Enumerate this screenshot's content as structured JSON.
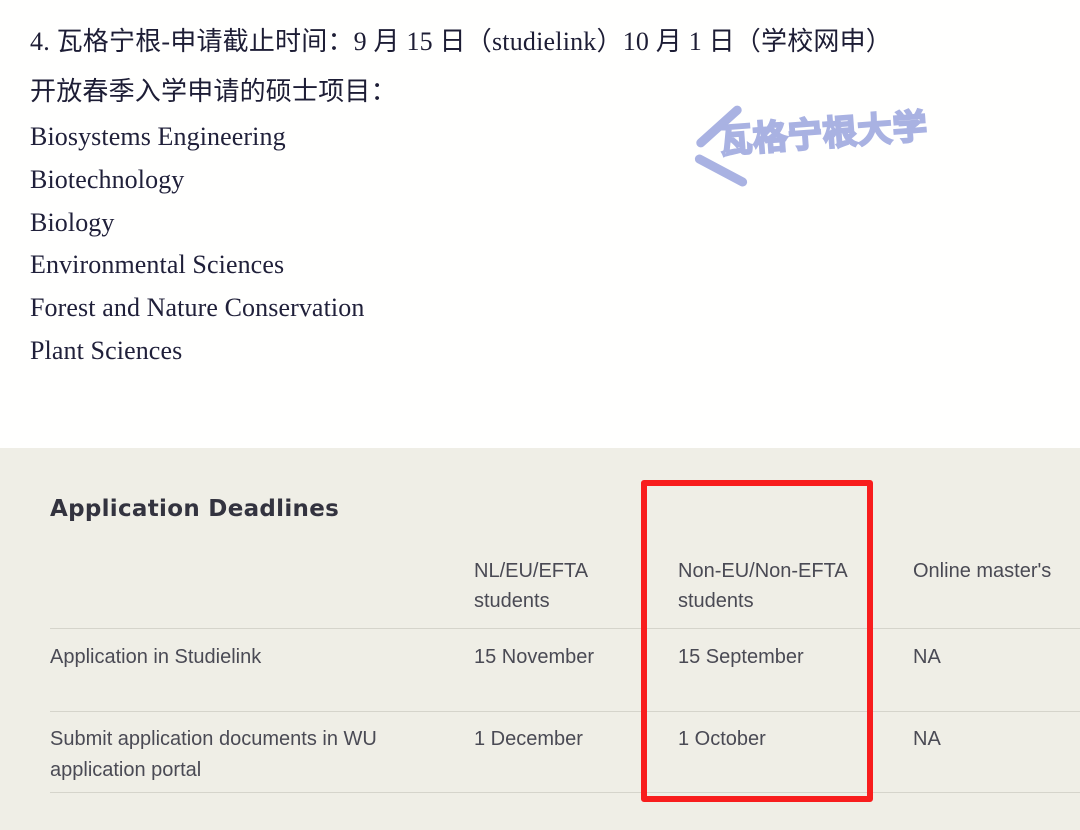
{
  "article": {
    "heading_line_1": "4. 瓦格宁根-申请截止时间：9 月 15 日（studielink）10 月 1 日（学校网申）",
    "heading_line_2": "开放春季入学申请的硕士项目：",
    "programs": [
      "Biosystems Engineering",
      "Biotechnology",
      "Biology",
      "Environmental Sciences",
      "Forest and Nature Conservation",
      "Plant Sciences"
    ]
  },
  "watermark": {
    "text": "瓦格宁根大学",
    "color": "#a9b2e2"
  },
  "deadlines": {
    "title": "Application Deadlines",
    "columns": [
      "NL/EU/EFTA students",
      "Non-EU/Non-EFTA students",
      "Online master's"
    ],
    "rows": [
      {
        "label": "Application in Studielink",
        "values": [
          "15 November",
          "15 September",
          "NA"
        ]
      },
      {
        "label": "Submit application documents in WU application portal",
        "values": [
          "1 December",
          "1 October",
          "NA"
        ]
      }
    ],
    "panel_color": "#efeee6"
  },
  "annotation": {
    "highlight_color": "#f81d1d",
    "highlighted_column": "Non-EU/Non-EFTA students"
  }
}
